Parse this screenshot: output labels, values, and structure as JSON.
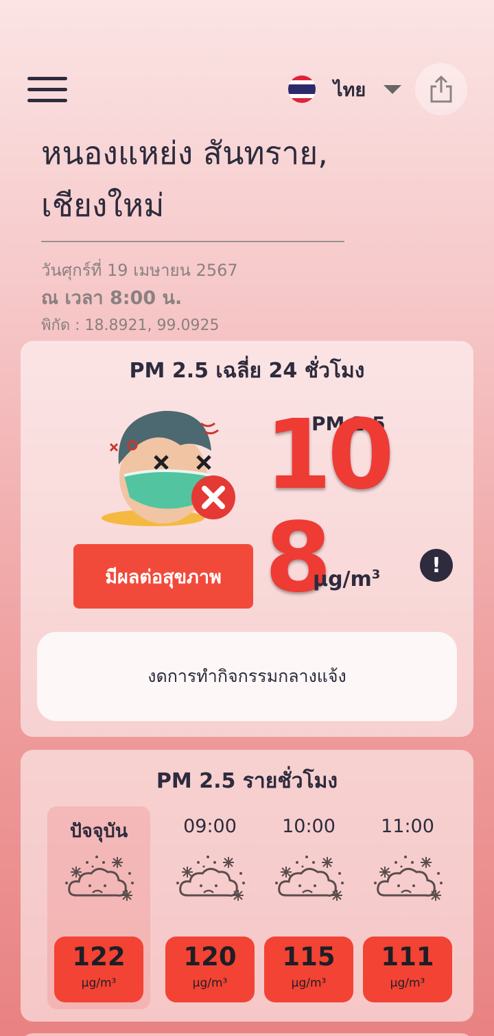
{
  "header": {
    "menu_icon": "hamburger-menu-icon",
    "language": {
      "flag_icon": "thai-flag-icon",
      "label": "ไทย"
    },
    "share_icon": "share-icon"
  },
  "location": {
    "name": "หนองแหย่ง สันทราย, เชียงใหม่",
    "date": "วันศุกร์ที่ 19 เมษายน 2567",
    "time": "ณ เวลา 8:00 น.",
    "coordinates": "พิกัด : 18.8921, 99.0925"
  },
  "daily_card": {
    "title": "PM 2.5 เฉลี่ย 24 ชั่วโมง",
    "pm_label": "PM 2.5",
    "value": "108",
    "unit": "µg/m",
    "unit_sup": "3",
    "health_status": "มีผลต่อสุขภาพ",
    "info_icon": "!",
    "advice": "งดการทำกิจกรรมกลางแจ้ง",
    "colors": {
      "status": "#f14a3b",
      "value": "#ee3b34"
    }
  },
  "hourly_card": {
    "title": "PM 2.5 รายชั่วโมง",
    "hours": [
      {
        "label": "ปัจจุบัน",
        "value": "122",
        "unit": "µg/m³",
        "icon": "sad-cloud-haze-icon"
      },
      {
        "label": "09:00",
        "value": "120",
        "unit": "µg/m³",
        "icon": "sad-cloud-haze-icon"
      },
      {
        "label": "10:00",
        "value": "115",
        "unit": "µg/m³",
        "icon": "sad-cloud-haze-icon"
      },
      {
        "label": "11:00",
        "value": "111",
        "unit": "µg/m³",
        "icon": "sad-cloud-haze-icon"
      }
    ]
  }
}
